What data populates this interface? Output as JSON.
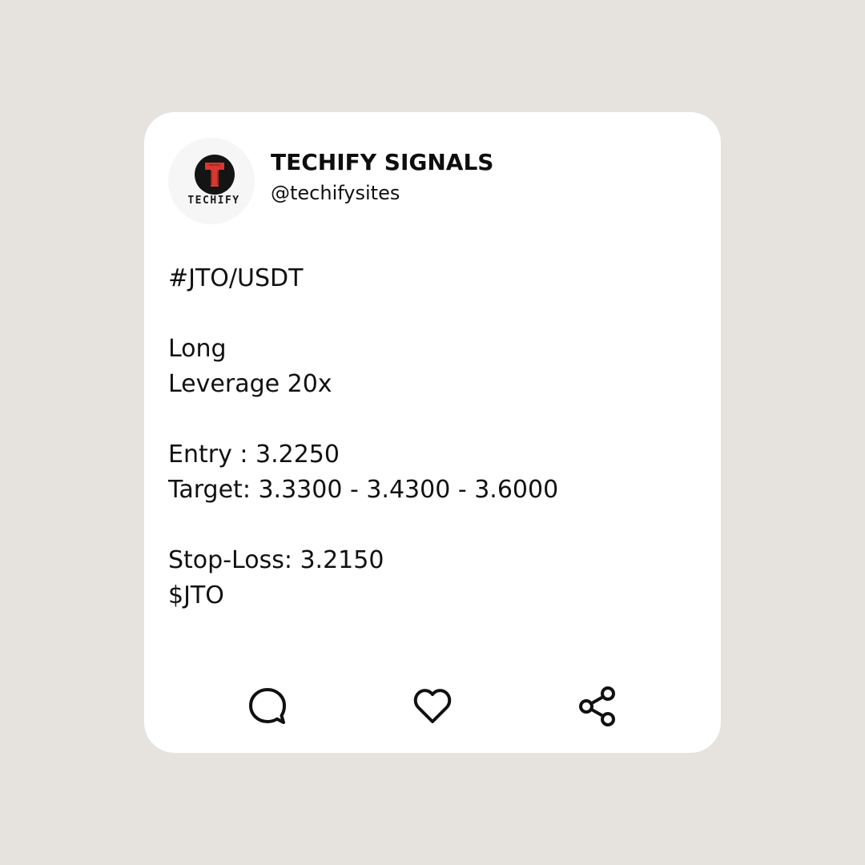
{
  "theme": {
    "page_background": "#e6e2de",
    "card_background": "#ffffff",
    "text_color": "#111111",
    "brand_red": "#d9382f",
    "avatar_black": "#141414"
  },
  "profile": {
    "avatar_icon": "techify-logo-icon",
    "avatar_text": "TECHIFY",
    "display_name": "TECHIFY SIGNALS",
    "handle": "@techifysites"
  },
  "post": {
    "pair": "#JTO/USDT",
    "direction": "Long",
    "leverage": "Leverage 20x",
    "entry": "Entry : 3.2250",
    "targets": "Target: 3.3300 - 3.4300 - 3.6000",
    "stop_loss": "Stop-Loss: 3.2150",
    "cashtag": "$JTO"
  },
  "actions": [
    {
      "icon": "comment-icon"
    },
    {
      "icon": "heart-icon"
    },
    {
      "icon": "share-icon"
    }
  ]
}
